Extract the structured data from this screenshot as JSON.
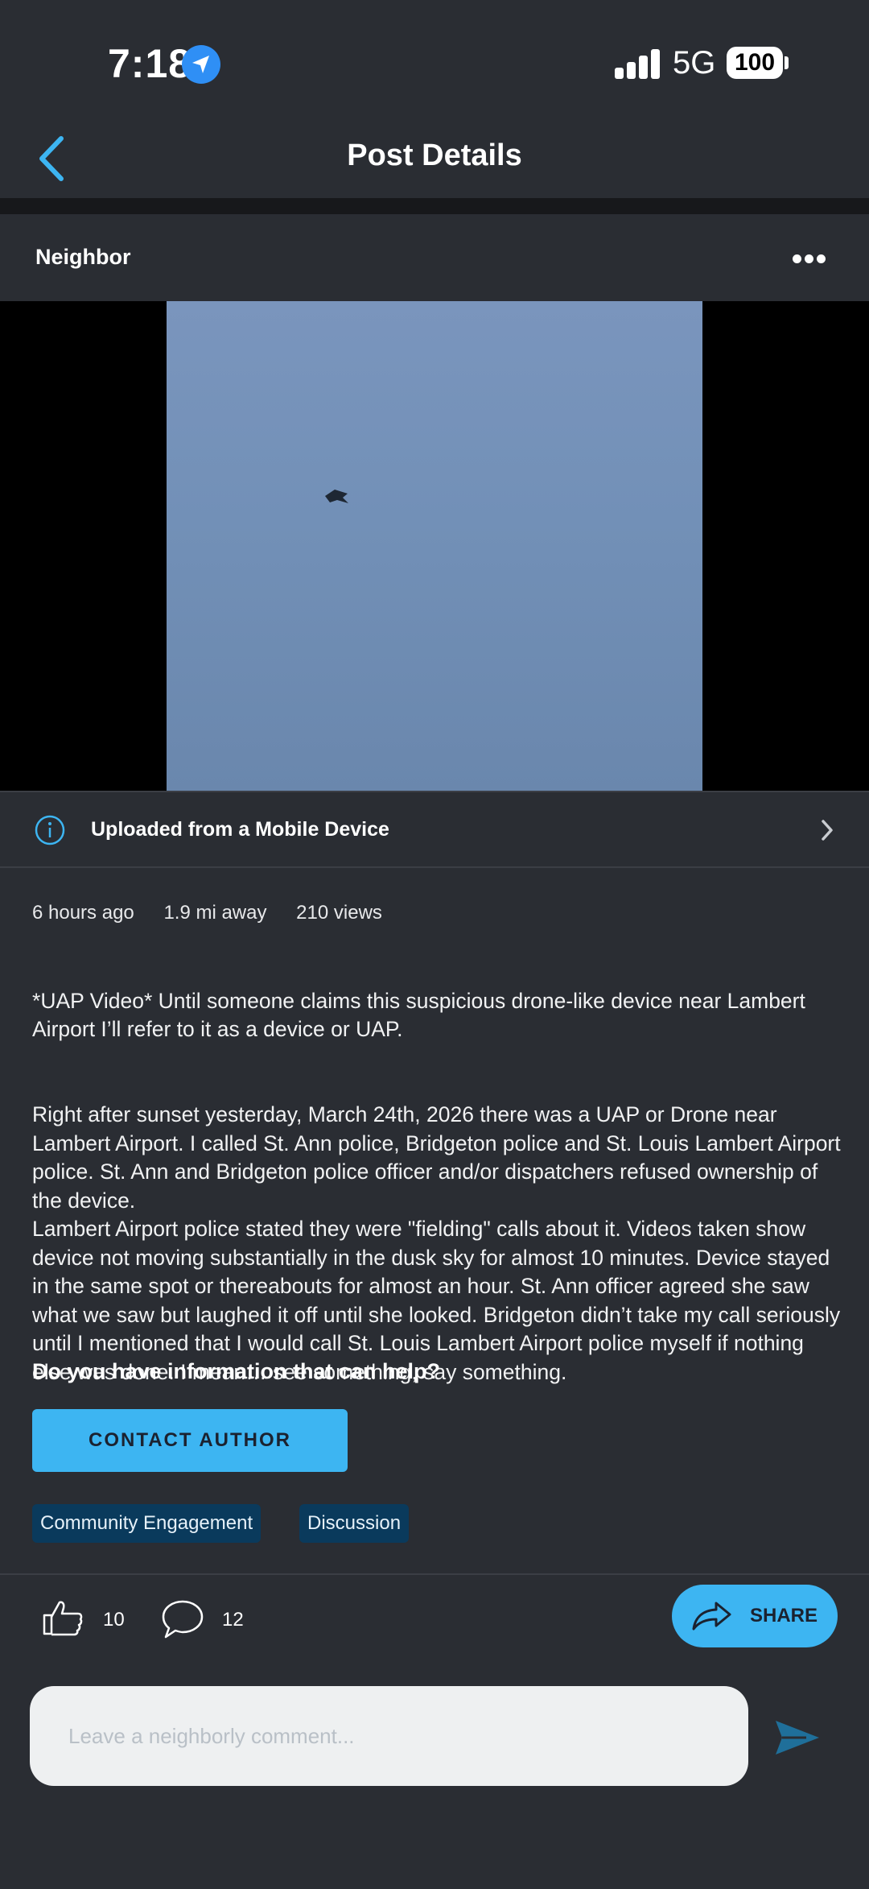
{
  "status_bar": {
    "time": "7:18",
    "network": "5G",
    "battery": "100",
    "icons": [
      "location-arrow-icon",
      "cellular-signal-icon",
      "battery-icon"
    ]
  },
  "nav": {
    "title": "Post Details",
    "back_icon": "chevron-left-icon"
  },
  "post": {
    "author": "Neighbor",
    "more_icon": "more-dots-icon",
    "upload_notice": "Uploaded from a Mobile Device",
    "meta": {
      "posted": "6 hours ago",
      "distance": "1.9 mi away",
      "views": "210 views"
    },
    "paragraphs": [
      "*UAP Video* Until someone claims this suspicious drone-like device near Lambert Airport I’ll refer to it as a device or UAP.",
      "Right after sunset yesterday, March 24th, 2026 there was a UAP or Drone near Lambert Airport. I called St. Ann police, Bridgeton police and St. Louis Lambert Airport police. St. Ann and Bridgeton police officer and/or dispatchers refused ownership of the device.\nLambert Airport police stated they were \"fielding\" calls about it. Videos taken show device not moving substantially in the dusk sky for almost 10 minutes. Device stayed in the same spot or thereabouts for almost an hour. St. Ann officer agreed she saw what we saw but laughed it off until she looked. Bridgeton didn’t take my call seriously until I mentioned that I would call St. Louis Lambert Airport police myself if nothing else was done. I mean… see something, say something."
    ],
    "help_question": "Do you have information that can help?",
    "contact_label": "CONTACT AUTHOR",
    "tags": [
      "Community Engagement",
      "Discussion"
    ]
  },
  "actions": {
    "likes": "10",
    "comments": "12",
    "share_label": "SHARE"
  },
  "composer": {
    "placeholder": "Leave a neighborly comment..."
  },
  "colors": {
    "background": "#2a2d33",
    "accent": "#3db5f2",
    "tag_bg": "#0a3a5c",
    "link_blue": "#2f8ff5"
  }
}
